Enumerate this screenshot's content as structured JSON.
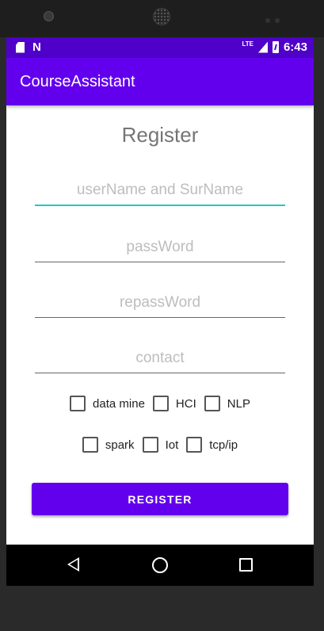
{
  "status_bar": {
    "network": "LTE",
    "time": "6:43"
  },
  "app_bar": {
    "title": "CourseAssistant"
  },
  "form": {
    "title": "Register",
    "fields": [
      {
        "placeholder": "userName and SurName",
        "value": ""
      },
      {
        "placeholder": "passWord",
        "value": ""
      },
      {
        "placeholder": "repassWord",
        "value": ""
      },
      {
        "placeholder": "contact",
        "value": ""
      }
    ],
    "courses_row1": [
      {
        "label": "data mine",
        "checked": false
      },
      {
        "label": "HCI",
        "checked": false
      },
      {
        "label": "NLP",
        "checked": false
      }
    ],
    "courses_row2": [
      {
        "label": "spark",
        "checked": false
      },
      {
        "label": "Iot",
        "checked": false
      },
      {
        "label": "tcp/ip",
        "checked": false
      }
    ],
    "register_button": "REGISTER"
  },
  "colors": {
    "primary": "#6200ee",
    "status_bar": "#4f00c9",
    "accent": "#1fc8c8"
  },
  "icons": [
    "sd-card-icon",
    "n-notification-icon",
    "signal-icon",
    "battery-icon",
    "back-icon",
    "home-icon",
    "recents-icon"
  ]
}
